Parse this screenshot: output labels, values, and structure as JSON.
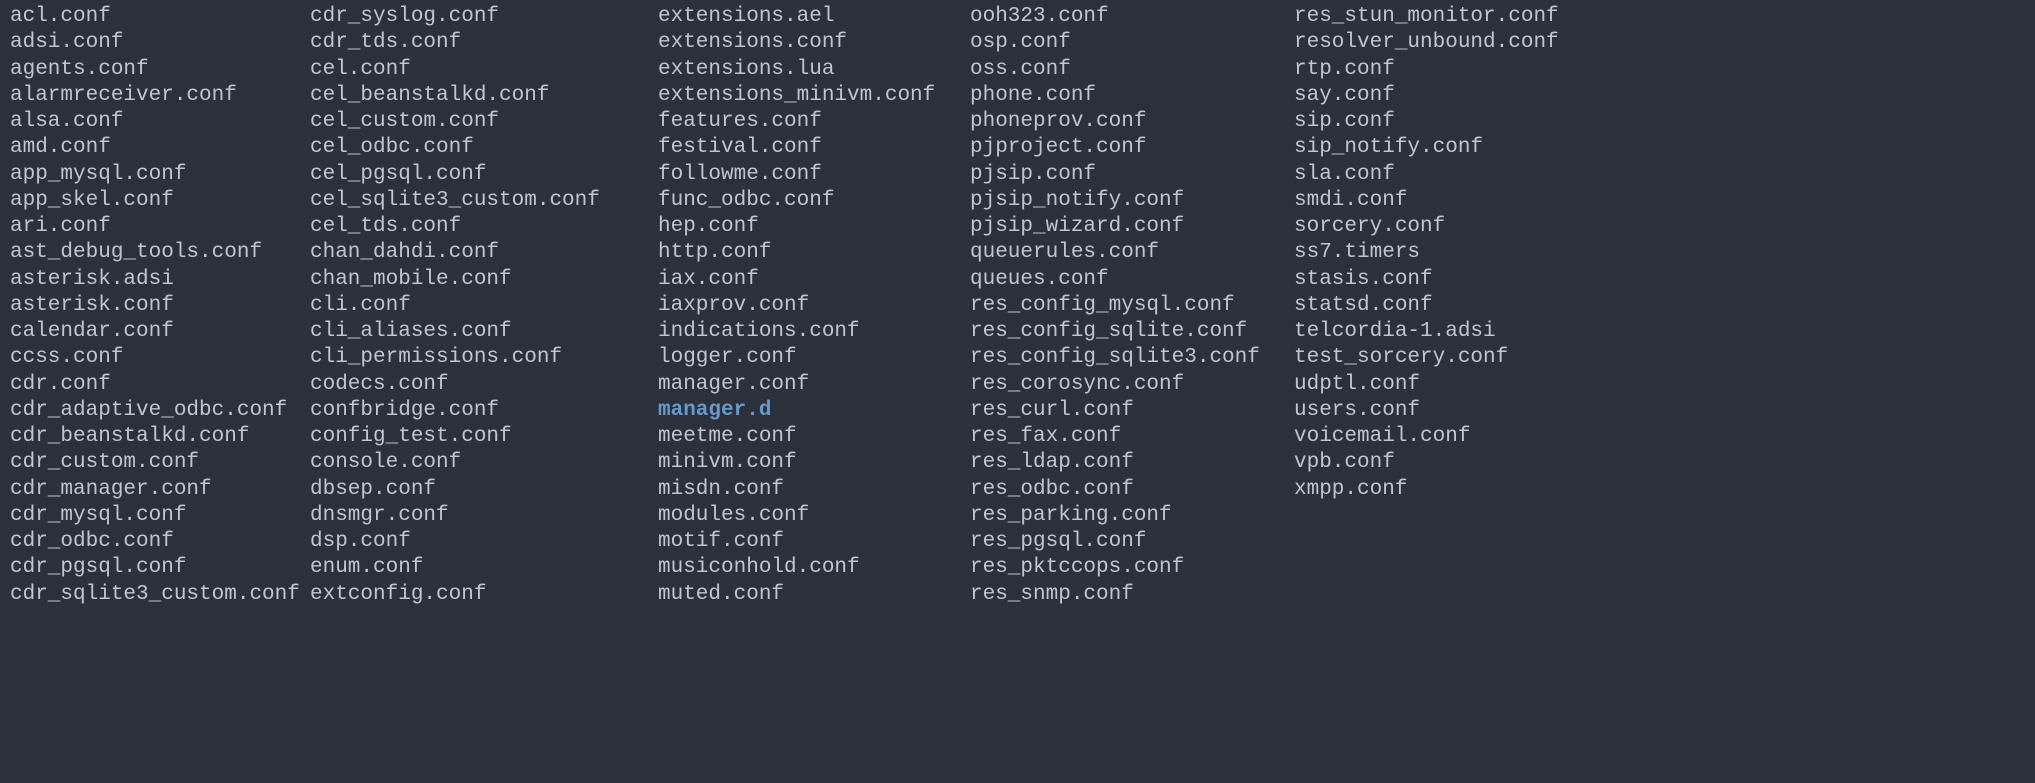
{
  "columns": [
    {
      "entries": [
        {
          "name": "acl.conf",
          "type": "file"
        },
        {
          "name": "adsi.conf",
          "type": "file"
        },
        {
          "name": "agents.conf",
          "type": "file"
        },
        {
          "name": "alarmreceiver.conf",
          "type": "file"
        },
        {
          "name": "alsa.conf",
          "type": "file"
        },
        {
          "name": "amd.conf",
          "type": "file"
        },
        {
          "name": "app_mysql.conf",
          "type": "file"
        },
        {
          "name": "app_skel.conf",
          "type": "file"
        },
        {
          "name": "ari.conf",
          "type": "file"
        },
        {
          "name": "ast_debug_tools.conf",
          "type": "file"
        },
        {
          "name": "asterisk.adsi",
          "type": "file"
        },
        {
          "name": "asterisk.conf",
          "type": "file"
        },
        {
          "name": "calendar.conf",
          "type": "file"
        },
        {
          "name": "ccss.conf",
          "type": "file"
        },
        {
          "name": "cdr.conf",
          "type": "file"
        },
        {
          "name": "cdr_adaptive_odbc.conf",
          "type": "file"
        },
        {
          "name": "cdr_beanstalkd.conf",
          "type": "file"
        },
        {
          "name": "cdr_custom.conf",
          "type": "file"
        },
        {
          "name": "cdr_manager.conf",
          "type": "file"
        },
        {
          "name": "cdr_mysql.conf",
          "type": "file"
        },
        {
          "name": "cdr_odbc.conf",
          "type": "file"
        },
        {
          "name": "cdr_pgsql.conf",
          "type": "file"
        },
        {
          "name": "cdr_sqlite3_custom.conf",
          "type": "file"
        }
      ]
    },
    {
      "entries": [
        {
          "name": "cdr_syslog.conf",
          "type": "file"
        },
        {
          "name": "cdr_tds.conf",
          "type": "file"
        },
        {
          "name": "cel.conf",
          "type": "file"
        },
        {
          "name": "cel_beanstalkd.conf",
          "type": "file"
        },
        {
          "name": "cel_custom.conf",
          "type": "file"
        },
        {
          "name": "cel_odbc.conf",
          "type": "file"
        },
        {
          "name": "cel_pgsql.conf",
          "type": "file"
        },
        {
          "name": "cel_sqlite3_custom.conf",
          "type": "file"
        },
        {
          "name": "cel_tds.conf",
          "type": "file"
        },
        {
          "name": "chan_dahdi.conf",
          "type": "file"
        },
        {
          "name": "chan_mobile.conf",
          "type": "file"
        },
        {
          "name": "cli.conf",
          "type": "file"
        },
        {
          "name": "cli_aliases.conf",
          "type": "file"
        },
        {
          "name": "cli_permissions.conf",
          "type": "file"
        },
        {
          "name": "codecs.conf",
          "type": "file"
        },
        {
          "name": "confbridge.conf",
          "type": "file"
        },
        {
          "name": "config_test.conf",
          "type": "file"
        },
        {
          "name": "console.conf",
          "type": "file"
        },
        {
          "name": "dbsep.conf",
          "type": "file"
        },
        {
          "name": "dnsmgr.conf",
          "type": "file"
        },
        {
          "name": "dsp.conf",
          "type": "file"
        },
        {
          "name": "enum.conf",
          "type": "file"
        },
        {
          "name": "extconfig.conf",
          "type": "file"
        }
      ]
    },
    {
      "entries": [
        {
          "name": "extensions.ael",
          "type": "file"
        },
        {
          "name": "extensions.conf",
          "type": "file"
        },
        {
          "name": "extensions.lua",
          "type": "file"
        },
        {
          "name": "extensions_minivm.conf",
          "type": "file"
        },
        {
          "name": "features.conf",
          "type": "file"
        },
        {
          "name": "festival.conf",
          "type": "file"
        },
        {
          "name": "followme.conf",
          "type": "file"
        },
        {
          "name": "func_odbc.conf",
          "type": "file"
        },
        {
          "name": "hep.conf",
          "type": "file"
        },
        {
          "name": "http.conf",
          "type": "file"
        },
        {
          "name": "iax.conf",
          "type": "file"
        },
        {
          "name": "iaxprov.conf",
          "type": "file"
        },
        {
          "name": "indications.conf",
          "type": "file"
        },
        {
          "name": "logger.conf",
          "type": "file"
        },
        {
          "name": "manager.conf",
          "type": "file"
        },
        {
          "name": "manager.d",
          "type": "dir"
        },
        {
          "name": "meetme.conf",
          "type": "file"
        },
        {
          "name": "minivm.conf",
          "type": "file"
        },
        {
          "name": "misdn.conf",
          "type": "file"
        },
        {
          "name": "modules.conf",
          "type": "file"
        },
        {
          "name": "motif.conf",
          "type": "file"
        },
        {
          "name": "musiconhold.conf",
          "type": "file"
        },
        {
          "name": "muted.conf",
          "type": "file"
        }
      ]
    },
    {
      "entries": [
        {
          "name": "ooh323.conf",
          "type": "file"
        },
        {
          "name": "osp.conf",
          "type": "file"
        },
        {
          "name": "oss.conf",
          "type": "file"
        },
        {
          "name": "phone.conf",
          "type": "file"
        },
        {
          "name": "phoneprov.conf",
          "type": "file"
        },
        {
          "name": "pjproject.conf",
          "type": "file"
        },
        {
          "name": "pjsip.conf",
          "type": "file"
        },
        {
          "name": "pjsip_notify.conf",
          "type": "file"
        },
        {
          "name": "pjsip_wizard.conf",
          "type": "file"
        },
        {
          "name": "queuerules.conf",
          "type": "file"
        },
        {
          "name": "queues.conf",
          "type": "file"
        },
        {
          "name": "res_config_mysql.conf",
          "type": "file"
        },
        {
          "name": "res_config_sqlite.conf",
          "type": "file"
        },
        {
          "name": "res_config_sqlite3.conf",
          "type": "file"
        },
        {
          "name": "res_corosync.conf",
          "type": "file"
        },
        {
          "name": "res_curl.conf",
          "type": "file"
        },
        {
          "name": "res_fax.conf",
          "type": "file"
        },
        {
          "name": "res_ldap.conf",
          "type": "file"
        },
        {
          "name": "res_odbc.conf",
          "type": "file"
        },
        {
          "name": "res_parking.conf",
          "type": "file"
        },
        {
          "name": "res_pgsql.conf",
          "type": "file"
        },
        {
          "name": "res_pktccops.conf",
          "type": "file"
        },
        {
          "name": "res_snmp.conf",
          "type": "file"
        }
      ]
    },
    {
      "entries": [
        {
          "name": "res_stun_monitor.conf",
          "type": "file"
        },
        {
          "name": "resolver_unbound.conf",
          "type": "file"
        },
        {
          "name": "rtp.conf",
          "type": "file"
        },
        {
          "name": "say.conf",
          "type": "file"
        },
        {
          "name": "sip.conf",
          "type": "file"
        },
        {
          "name": "sip_notify.conf",
          "type": "file"
        },
        {
          "name": "sla.conf",
          "type": "file"
        },
        {
          "name": "smdi.conf",
          "type": "file"
        },
        {
          "name": "sorcery.conf",
          "type": "file"
        },
        {
          "name": "ss7.timers",
          "type": "file"
        },
        {
          "name": "stasis.conf",
          "type": "file"
        },
        {
          "name": "statsd.conf",
          "type": "file"
        },
        {
          "name": "telcordia-1.adsi",
          "type": "file"
        },
        {
          "name": "test_sorcery.conf",
          "type": "file"
        },
        {
          "name": "udptl.conf",
          "type": "file"
        },
        {
          "name": "users.conf",
          "type": "file"
        },
        {
          "name": "voicemail.conf",
          "type": "file"
        },
        {
          "name": "vpb.conf",
          "type": "file"
        },
        {
          "name": "xmpp.conf",
          "type": "file"
        }
      ]
    }
  ]
}
